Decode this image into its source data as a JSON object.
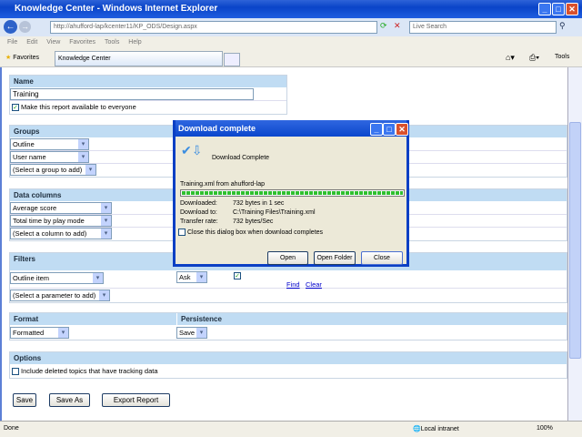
{
  "window": {
    "title": "Knowledge Center - Windows Internet Explorer"
  },
  "address": {
    "url": "http://ahufford-lap/kcenter11/KP_ODS/Design.aspx",
    "search_placeholder": "Live Search"
  },
  "menu": [
    "File",
    "Edit",
    "View",
    "Favorites",
    "Tools",
    "Help"
  ],
  "favbar": {
    "favorites": "Favorites",
    "tab": "Knowledge Center",
    "tools": "Tools"
  },
  "name_section": {
    "header": "Name",
    "value": "Training",
    "share_label": "Make this report available to everyone",
    "share_checked": true
  },
  "groups": {
    "header": "Groups",
    "items": [
      "Outline",
      "User name",
      "(Select a group to add)"
    ]
  },
  "data_columns": {
    "header": "Data columns",
    "items": [
      "Average score",
      "Total time by play mode",
      "(Select a column to add)"
    ]
  },
  "filters": {
    "header": "Filters",
    "item": "Outline item",
    "ask": "Ask",
    "add": "(Select a parameter to add)",
    "find": "Find",
    "clear": "Clear"
  },
  "format": {
    "header": "Format",
    "value": "Formatted"
  },
  "persistence": {
    "header": "Persistence",
    "value": "Save"
  },
  "options": {
    "header": "Options",
    "include_deleted": "Include deleted topics that have tracking data"
  },
  "buttons": {
    "save": "Save",
    "save_as": "Save As",
    "export": "Export Report"
  },
  "status": {
    "text": "Done",
    "zone": "Local intranet",
    "zoom": "100%"
  },
  "dialog": {
    "title": "Download complete",
    "heading": "Download Complete",
    "source": "Training.xml from ahufford-lap",
    "progress_percent": 100,
    "downloaded_label": "Downloaded:",
    "downloaded": "732 bytes in 1 sec",
    "to_label": "Download to:",
    "to": "C:\\Training Files\\Training.xml",
    "rate_label": "Transfer rate:",
    "rate": "732 bytes/Sec",
    "close_when_done": "Close this dialog box when download completes",
    "open": "Open",
    "open_folder": "Open Folder",
    "close": "Close"
  }
}
